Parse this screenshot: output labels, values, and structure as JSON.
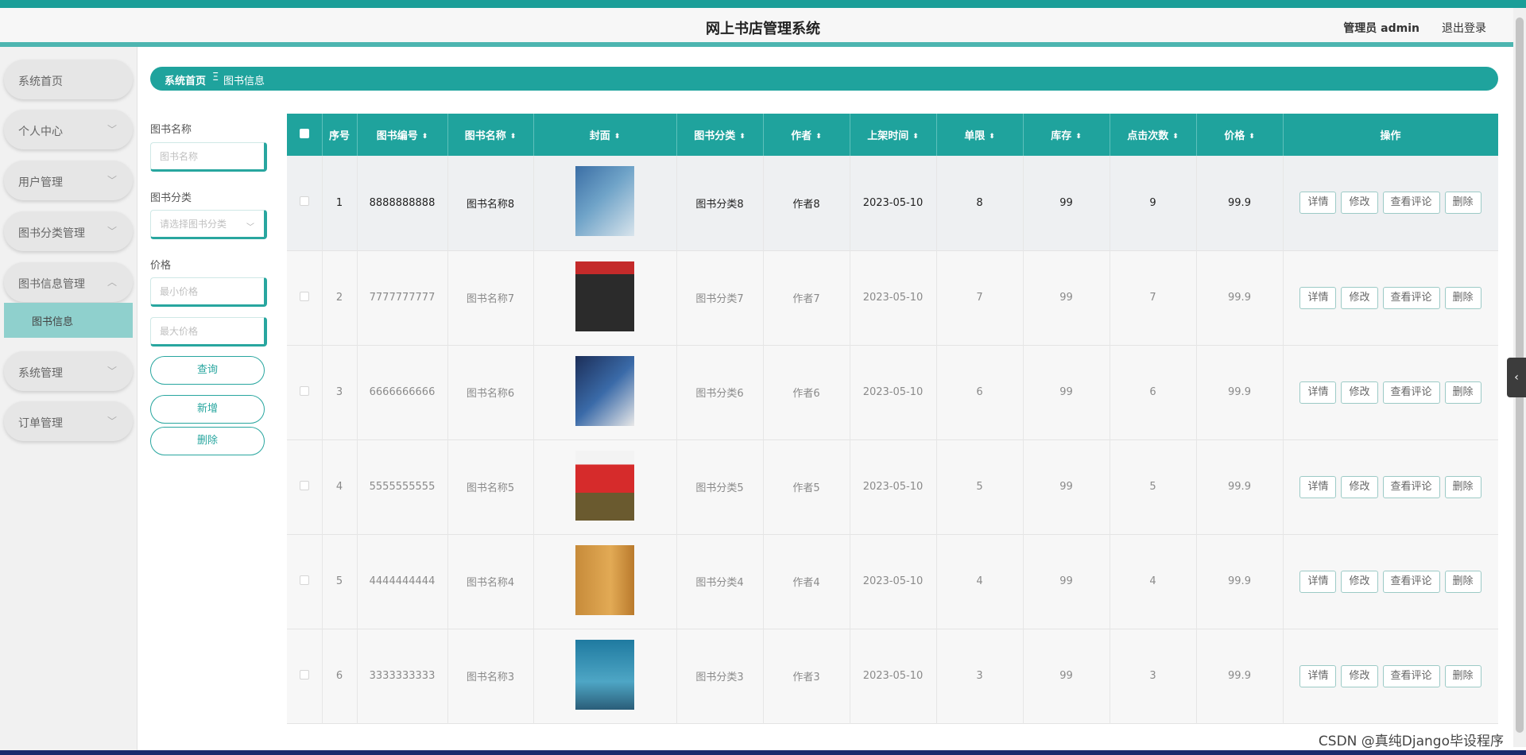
{
  "header": {
    "title": "网上书店管理系统",
    "admin": "管理员 admin",
    "logout": "退出登录"
  },
  "sidebar": {
    "items": [
      {
        "label": "系统首页"
      },
      {
        "label": "个人中心"
      },
      {
        "label": "用户管理"
      },
      {
        "label": "图书分类管理"
      },
      {
        "label": "图书信息管理"
      },
      {
        "label": "系统管理"
      },
      {
        "label": "订单管理"
      }
    ],
    "sub_item": "图书信息"
  },
  "breadcrumb": {
    "home": "系统首页",
    "separator": "Ξ",
    "current": "图书信息"
  },
  "filters": {
    "name_label": "图书名称",
    "name_placeholder": "图书名称",
    "category_label": "图书分类",
    "category_placeholder": "请选择图书分类",
    "price_label": "价格",
    "min_price_placeholder": "最小价格",
    "max_price_placeholder": "最大价格",
    "query": "查询",
    "add": "新增",
    "delete": "删除"
  },
  "table": {
    "columns": [
      "序号",
      "图书编号",
      "图书名称",
      "封面",
      "图书分类",
      "作者",
      "上架时间",
      "单限",
      "库存",
      "点击次数",
      "价格",
      "操作"
    ],
    "rows": [
      {
        "idx": "1",
        "code": "8888888888",
        "name": "图书名称8",
        "category": "图书分类8",
        "author": "作者8",
        "date": "2023-05-10",
        "limit": "8",
        "stock": "99",
        "clicks": "9",
        "price": "99.9"
      },
      {
        "idx": "2",
        "code": "7777777777",
        "name": "图书名称7",
        "category": "图书分类7",
        "author": "作者7",
        "date": "2023-05-10",
        "limit": "7",
        "stock": "99",
        "clicks": "7",
        "price": "99.9"
      },
      {
        "idx": "3",
        "code": "6666666666",
        "name": "图书名称6",
        "category": "图书分类6",
        "author": "作者6",
        "date": "2023-05-10",
        "limit": "6",
        "stock": "99",
        "clicks": "6",
        "price": "99.9"
      },
      {
        "idx": "4",
        "code": "5555555555",
        "name": "图书名称5",
        "category": "图书分类5",
        "author": "作者5",
        "date": "2023-05-10",
        "limit": "5",
        "stock": "99",
        "clicks": "5",
        "price": "99.9"
      },
      {
        "idx": "5",
        "code": "4444444444",
        "name": "图书名称4",
        "category": "图书分类4",
        "author": "作者4",
        "date": "2023-05-10",
        "limit": "4",
        "stock": "99",
        "clicks": "4",
        "price": "99.9"
      },
      {
        "idx": "6",
        "code": "3333333333",
        "name": "图书名称3",
        "category": "图书分类3",
        "author": "作者3",
        "date": "2023-05-10",
        "limit": "3",
        "stock": "99",
        "clicks": "3",
        "price": "99.9"
      }
    ],
    "actions": [
      "详情",
      "修改",
      "查看评论",
      "删除"
    ]
  },
  "watermark": "CSDN @真纯Django毕设程序"
}
